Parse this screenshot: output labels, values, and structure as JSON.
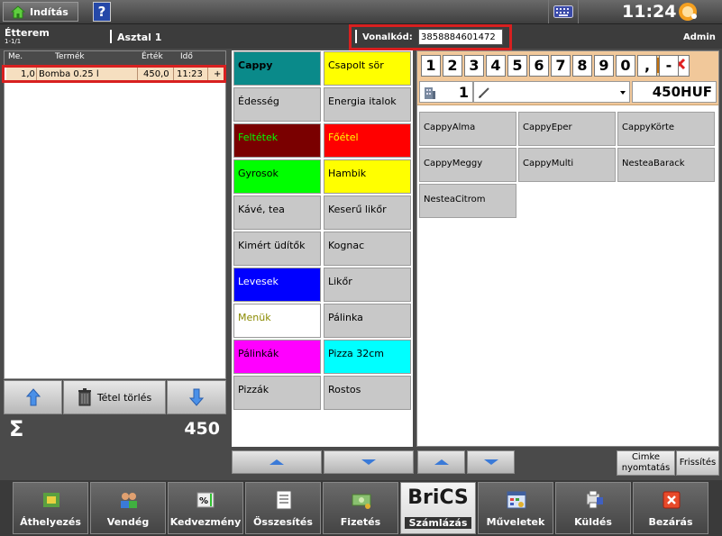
{
  "taskbar": {
    "start_label": "Indítás",
    "help_label": "?",
    "clock": "11:24",
    "icons": [
      "house-icon",
      "keyboard-icon",
      "brand-logo-icon"
    ]
  },
  "header": {
    "venue": "Étterem",
    "venue_sub": "1-1/1",
    "table": "Asztal 1",
    "barcode_label": "Vonalkód:",
    "barcode_value": "3858884601472",
    "user": "Admin"
  },
  "order": {
    "columns": [
      "Me.",
      "Termék",
      "Érték",
      "Idő"
    ],
    "rows": [
      {
        "qty": "1,0",
        "product": "Bomba 0.25 l",
        "value": "450,0",
        "time": "11:23",
        "action": "+"
      }
    ],
    "delete_label": "Tétel törlés",
    "sum_sign": "Σ",
    "sum_value": "450"
  },
  "categories": [
    {
      "label": "Cappy",
      "bg": "#0a8a8a",
      "fg": "#000000",
      "bold": true
    },
    {
      "label": "Csapolt sör",
      "bg": "#ffff00",
      "fg": "#000000"
    },
    {
      "label": "Édesség",
      "bg": "#c8c8c8",
      "fg": "#000000"
    },
    {
      "label": "Energia italok",
      "bg": "#c8c8c8",
      "fg": "#000000"
    },
    {
      "label": "Feltétek",
      "bg": "#7a0000",
      "fg": "#00ff00"
    },
    {
      "label": "Főétel",
      "bg": "#ff0000",
      "fg": "#ffff00"
    },
    {
      "label": "Gyrosok",
      "bg": "#00ff00",
      "fg": "#000000"
    },
    {
      "label": "Hambik",
      "bg": "#ffff00",
      "fg": "#000000"
    },
    {
      "label": "Kávé, tea",
      "bg": "#c8c8c8",
      "fg": "#000000"
    },
    {
      "label": "Keserű likőr",
      "bg": "#c8c8c8",
      "fg": "#000000"
    },
    {
      "label": "Kimért üdítők",
      "bg": "#c8c8c8",
      "fg": "#000000"
    },
    {
      "label": "Kognac",
      "bg": "#c8c8c8",
      "fg": "#000000"
    },
    {
      "label": "Levesek",
      "bg": "#0000ff",
      "fg": "#ffffff"
    },
    {
      "label": "Likőr",
      "bg": "#c8c8c8",
      "fg": "#000000"
    },
    {
      "label": "Menük",
      "bg": "#ffffff",
      "fg": "#8a8a00"
    },
    {
      "label": "Pálinka",
      "bg": "#c8c8c8",
      "fg": "#000000"
    },
    {
      "label": "Pálinkák",
      "bg": "#ff00ff",
      "fg": "#000000"
    },
    {
      "label": "Pizza 32cm",
      "bg": "#00ffff",
      "fg": "#000000"
    },
    {
      "label": "Pizzák",
      "bg": "#c8c8c8",
      "fg": "#000000"
    },
    {
      "label": "Rostos",
      "bg": "#c8c8c8",
      "fg": "#000000"
    }
  ],
  "keypad": {
    "keys": [
      "1",
      "2",
      "3",
      "4",
      "5",
      "6",
      "7",
      "8",
      "9",
      "0",
      ",",
      "-"
    ],
    "quantity": "1",
    "price": "450HUF",
    "icons": [
      "scale-icon",
      "clear-x-icon",
      "building-icon",
      "pencil-icon",
      "dropdown-arrow-icon"
    ]
  },
  "products": [
    "CappyAlma",
    "CappyEper",
    "CappyKörte",
    "CappyMeggy",
    "CappyMulti",
    "NesteaBarack",
    "NesteaCitrom"
  ],
  "right_buttons": {
    "label_print": "Cimke nyomtatás",
    "refresh": "Frissítés"
  },
  "toolbar": [
    {
      "label": "Áthelyezés",
      "icon": "move-arrows-icon"
    },
    {
      "label": "Vendég",
      "icon": "guests-icon"
    },
    {
      "label": "Kedvezmény",
      "icon": "discount-icon"
    },
    {
      "label": "Összesítés",
      "icon": "summary-icon"
    },
    {
      "label": "Fizetés",
      "icon": "payment-icon"
    },
    {
      "label": "Számlázás",
      "icon": "brics-logo-icon",
      "logo_text": "BriCS"
    },
    {
      "label": "Műveletek",
      "icon": "operations-icon"
    },
    {
      "label": "Küldés",
      "icon": "send-icon"
    },
    {
      "label": "Bezárás",
      "icon": "close-icon"
    }
  ]
}
